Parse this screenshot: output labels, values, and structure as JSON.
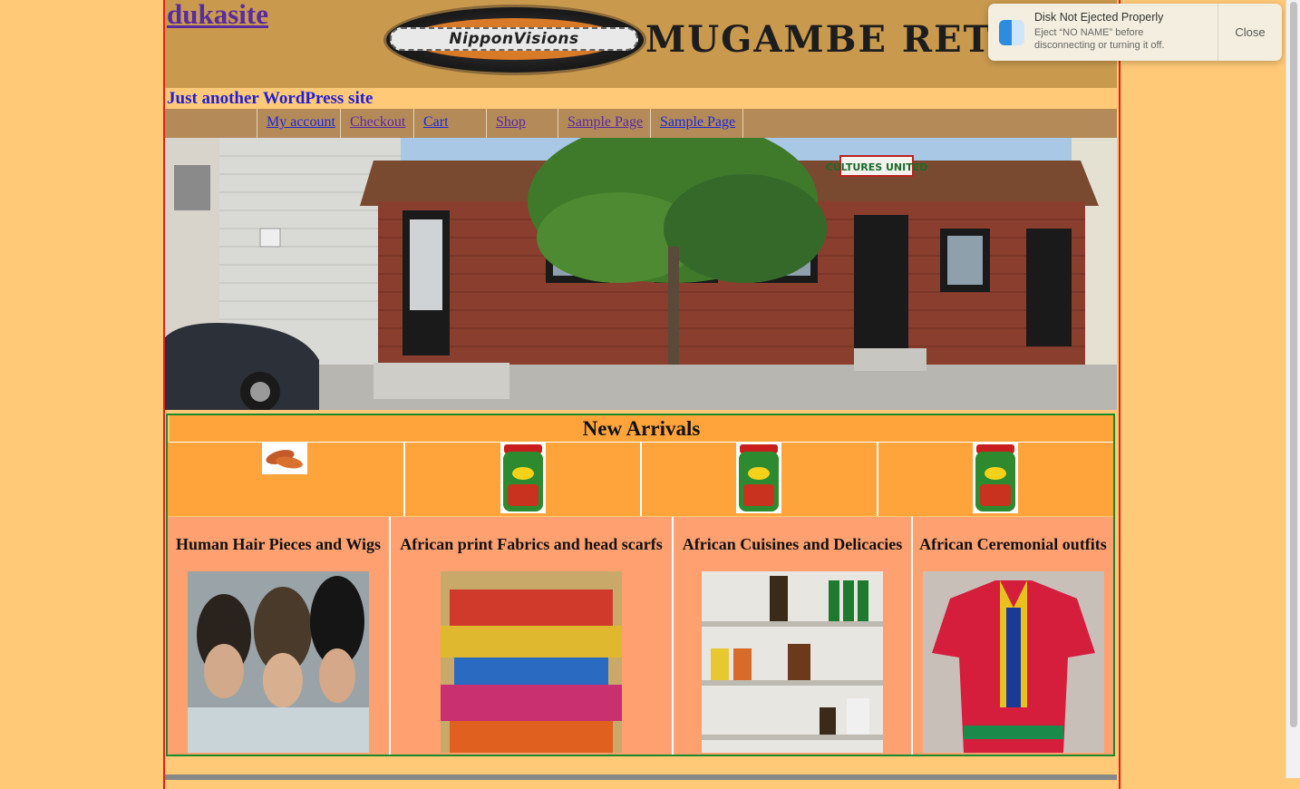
{
  "site": {
    "title": "dukasite",
    "tagline": "Just another WordPress site"
  },
  "header": {
    "logo_text": "NipponVisions",
    "brand_text": "MUGAMBE RETAIL S"
  },
  "nav": {
    "items": [
      {
        "label": "My account"
      },
      {
        "label": "Checkout"
      },
      {
        "label": "Cart"
      },
      {
        "label": "Shop"
      },
      {
        "label": "Sample Page"
      },
      {
        "label": "Sample Page"
      }
    ]
  },
  "hero": {
    "sign_text": "CULTURES UNITED"
  },
  "new_arrivals": {
    "title": "New Arrivals",
    "products": [
      "sweet-potato-image",
      "royco-jar-image",
      "royco-jar-image",
      "royco-jar-image"
    ]
  },
  "categories": [
    {
      "title": "Human Hair Pieces and Wigs"
    },
    {
      "title": "African print Fabrics and head scarfs"
    },
    {
      "title": "African Cuisines and Delicacies"
    },
    {
      "title": "African Ceremonial outfits"
    }
  ],
  "notification": {
    "title": "Disk Not Ejected Properly",
    "body": "Eject “NO NAME” before disconnecting or turning it off.",
    "close_label": "Close"
  },
  "colors": {
    "page_bg": "#ffc978",
    "header_bg": "#c99a4e",
    "nav_bg": "#b48a58",
    "arrivals_bg": "#ffa43a",
    "category_bg": "#ffa070",
    "page_border": "#e02020",
    "arrivals_border": "#1a8a2a"
  }
}
